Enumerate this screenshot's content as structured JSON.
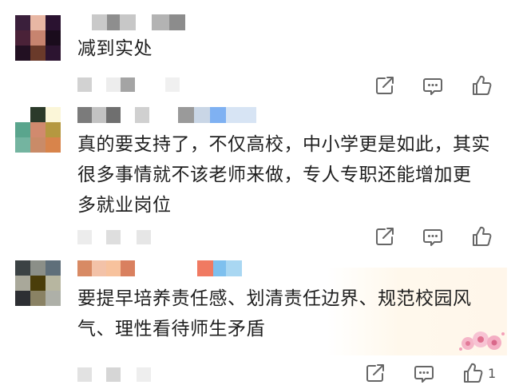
{
  "comments": [
    {
      "text": "减到实处",
      "avatar_colors": [
        "#3a1f3b",
        "#e8b7a4",
        "#2a1230",
        "#4a2238",
        "#c7846f",
        "#1a0c1c",
        "#221022",
        "#6a3a2a",
        "#2c1430"
      ],
      "name_blocks": [
        "#c9c9c9",
        "#8e8e8e",
        "#c7c7c7",
        "#ffffff",
        "#b3b3b3",
        "#8c8c8c"
      ],
      "meta_blocks": [
        "#d2d2d2",
        "#ffffff",
        "#ededed",
        "#a4a4a4",
        "#ffffff",
        "#f0f0f0"
      ]
    },
    {
      "text": "真的要支持了，不仅高校，中小学更是如此，其实\n很多事情就不该老师来做，专人专职还能增加更\n多就业岗位",
      "avatar_colors": [
        "#ffffff",
        "#2b3a2a",
        "#fbf6d8",
        "#5aa58d",
        "#d18a6e",
        "#b59840",
        "#74b4a0",
        "#c98b68",
        "#d8844b"
      ],
      "name_blocks": [
        "#7b7b7b",
        "#c2c2c2",
        "#6f6f6f",
        "#ffffff",
        "#d0d0d0",
        "#ffffff",
        "#9a9a9a",
        "#c9d6e6",
        "#7fb1f2",
        "#d7e4f4"
      ],
      "meta_blocks": [
        "#ececec",
        "#ffffff",
        "#dedede",
        "#ffffff",
        "#e6e6e6"
      ]
    },
    {
      "text": "要提早培养责任感、划清责任边界、规范校园风\n气、理性看待师生矛盾",
      "avatar_colors": [
        "#3b4244",
        "#8b8f88",
        "#5f6f7a",
        "#a9a89a",
        "#4a3d0a",
        "#b7b6a0",
        "#2d2f33",
        "#8a8264",
        "#aeb0a8"
      ],
      "name_blocks": [
        "#d88a64",
        "#f3c2a8",
        "#f7c29d",
        "#d9805f",
        "#ffffff",
        "#ffffff",
        "#f07a62",
        "#7ec0ee",
        "#a9d7f2"
      ],
      "meta_blocks": [
        "#e2e2e2",
        "#ffffff",
        "#d6d6d6",
        "#ffffff",
        "#eeeeee"
      ]
    }
  ],
  "icons": {
    "share": "share-icon",
    "reply": "comment-icon",
    "like": "thumbs-up-icon"
  },
  "like_count_3": "1"
}
